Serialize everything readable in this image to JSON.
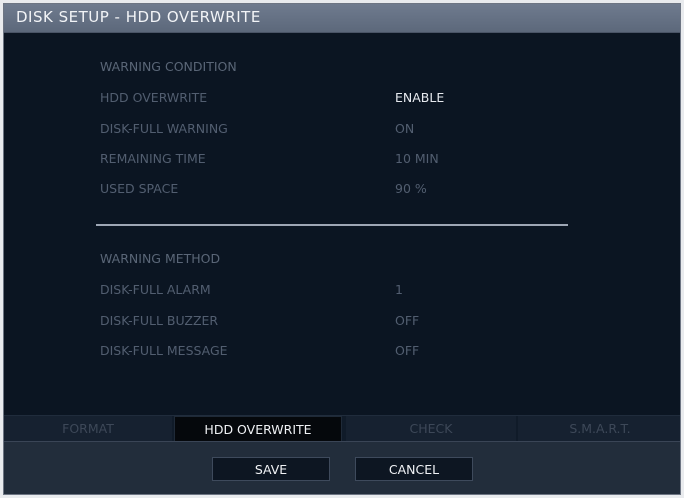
{
  "window": {
    "title": "DISK SETUP - HDD OVERWRITE"
  },
  "warning_condition": {
    "heading": "WARNING CONDITION",
    "rows": [
      {
        "label": "HDD OVERWRITE",
        "value": "ENABLE"
      },
      {
        "label": "DISK-FULL WARNING",
        "value": "ON"
      },
      {
        "label": "REMAINING TIME",
        "value": "10 MIN"
      },
      {
        "label": "USED SPACE",
        "value": "90 %"
      }
    ]
  },
  "warning_method": {
    "heading": "WARNING METHOD",
    "rows": [
      {
        "label": "DISK-FULL ALARM",
        "value": "1"
      },
      {
        "label": "DISK-FULL BUZZER",
        "value": "OFF"
      },
      {
        "label": "DISK-FULL MESSAGE",
        "value": "OFF"
      }
    ]
  },
  "tabs": [
    {
      "label": "FORMAT"
    },
    {
      "label": "HDD OVERWRITE"
    },
    {
      "label": "CHECK"
    },
    {
      "label": "S.M.A.R.T."
    }
  ],
  "active_tab": "HDD OVERWRITE",
  "buttons": {
    "save": "SAVE",
    "cancel": "CANCEL"
  },
  "colors": {
    "background": "#0b1522",
    "titlebar": "#5c687b",
    "active_text": "#e6e9ee",
    "inactive_text": "#525e70"
  }
}
